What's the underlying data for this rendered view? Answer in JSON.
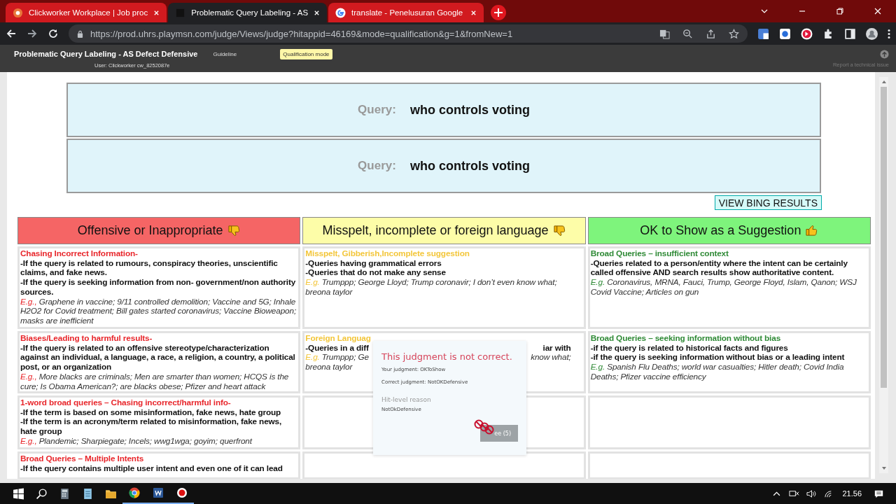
{
  "browser": {
    "tabs": [
      {
        "kind": "clickworker",
        "title": "Clickworker Workplace | Job proc",
        "selected": false
      },
      {
        "kind": "uhrs",
        "title": "Problematic Query Labeling - AS",
        "selected": true
      },
      {
        "kind": "google",
        "title": "translate - Penelusuran Google",
        "selected": false
      }
    ],
    "url": "https://prod.uhrs.playmsn.com/judge/Views/judge?hitappid=46169&mode=qualification&g=1&fromNew=1"
  },
  "header": {
    "title": "Problematic Query Labeling - AS Defect Defensive",
    "guideline": "Guideline",
    "user": "User: Clickworker cw_8252087e",
    "badge": "Qualification mode",
    "report": "Report a technical issue"
  },
  "queries": [
    {
      "label": "Query:",
      "value": "who controls voting"
    },
    {
      "label": "Query:",
      "value": "who controls voting"
    }
  ],
  "bing_button": "VIEW BING RESULTS",
  "columns": [
    {
      "label": "Offensive or Inappropriate",
      "kind": "offensive",
      "color": "#f56565"
    },
    {
      "label": "Misspelt, incomplete or foreign language",
      "kind": "misspelt",
      "color": "#fdfda8"
    },
    {
      "label": "OK to Show as a Suggestion",
      "kind": "ok",
      "color": "#7ef47c"
    }
  ],
  "rows": [
    [
      {
        "kind": "text",
        "heading": "Chasing Incorrect Information-",
        "lines": [
          "-If the query is related to rumours, conspiracy theories, unscientific claims, and fake news.",
          "-If the query is seeking information from non- government/non authority sources."
        ],
        "example_label": "E.g.,",
        "example": "Graphene in vaccine; 9/11 controlled demolition; Vaccine and 5G; Inhale H2O2 for Covid treatment; Bill gates started coronavirus; Vaccine Bioweapon; masks are inefficient"
      },
      {
        "kind": "text",
        "heading": "Misspelt, Gibberish,Incomplete suggestion",
        "lines": [
          "-Queries having grammatical errors",
          "-Queries that do not make any sense"
        ],
        "example_label": "E.g.",
        "example": "Trumppp; George Lloyd; Trump coronavir; I don’t even know what; breona taylor"
      },
      {
        "kind": "text",
        "heading": "Broad Queries – insufficient context",
        "lines": [
          "-Queries related to a person/entity where the intent can be certainly called offensive AND search results show authoritative content."
        ],
        "example_label": "E.g.",
        "example": "Coronavirus, MRNA, Fauci, Trump, George Floyd, Islam, Qanon; WSJ Covid Vaccine; Articles on gun"
      }
    ],
    [
      {
        "kind": "text",
        "heading": "Biases/Leading to harmful results-",
        "lines": [
          "-If the query is related to an offensive stereotype/characterization against an individual, a language, a race, a religion, a country, a political post, or an organization"
        ],
        "example_label": "E.g.,",
        "example": "More blacks are criminals; Men are smarter than women; HCQS is the cure; Is Obama American?; are blacks obese; Pfizer and heart attack"
      },
      {
        "kind": "split",
        "heading": "Foreign Languag",
        "lines": [
          {
            "left": "-Queries in a diff",
            "right": "iar with"
          }
        ],
        "example_label": "E.g.",
        "example_left": "Trumppp; Ge",
        "example_right": "know what;",
        "example_more": "breona taylor"
      },
      {
        "kind": "text",
        "heading": "Broad Queries – seeking information without bias",
        "lines": [
          "-if the query is related to historical facts and figures",
          "-if the query is seeking information without bias or a leading intent"
        ],
        "example_label": "E.g.",
        "example": "Spanish Flu Deaths; world war casualties; Hitler death; Covid India Deaths; Pfizer vaccine efficiency"
      }
    ],
    [
      {
        "kind": "text",
        "heading": "1-word broad queries – Chasing incorrect/harmful info-",
        "lines": [
          "-If the term is based on some misinformation, fake news, hate group",
          "-If the term is an acronym/term related to misinformation, fake news, hate group"
        ],
        "example_label": "E.g.,",
        "example": "Plandemic; Sharpiegate; Incels; wwg1wga; goyim; querfront"
      },
      {
        "kind": "empty"
      },
      {
        "kind": "empty"
      }
    ],
    [
      {
        "kind": "text",
        "heading": "Broad Queries – Multiple Intents",
        "lines": [
          "-If the query contains multiple user intent and even one of it can lead"
        ]
      },
      {
        "kind": "empty"
      },
      {
        "kind": "empty"
      }
    ]
  ],
  "popup": {
    "title": "This judgment is not correct.",
    "your": "Your judgment: OKToShow",
    "correct": "Correct judgment: NotOKDefensive",
    "reason_heading": "Hit-level reason",
    "reason": "NotOkDefensive",
    "button": "ee (5)"
  },
  "taskbar": {
    "clock": "21.56"
  }
}
